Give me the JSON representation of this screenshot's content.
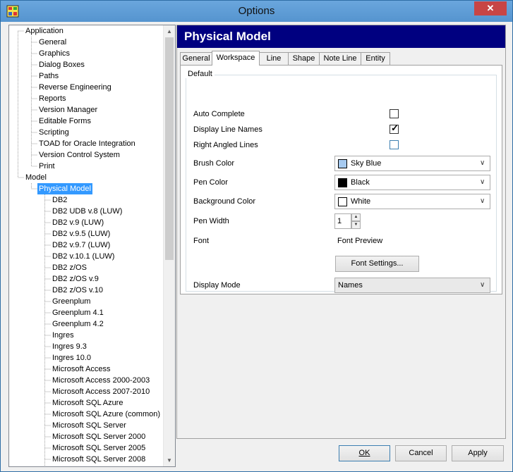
{
  "window": {
    "title": "Options",
    "close_glyph": "✕"
  },
  "tree": {
    "items": [
      "Application",
      "General",
      "Graphics",
      "Dialog Boxes",
      "Paths",
      "Reverse Engineering",
      "Reports",
      "Version Manager",
      "Editable Forms",
      "Scripting",
      "TOAD for Oracle Integration",
      "Version Control System",
      "Print",
      "Model",
      "Physical Model",
      "DB2",
      "DB2 UDB v.8 (LUW)",
      "DB2 v.9 (LUW)",
      "DB2 v.9.5 (LUW)",
      "DB2 v.9.7 (LUW)",
      "DB2 v.10.1 (LUW)",
      "DB2 z/OS",
      "DB2 z/OS v.9",
      "DB2 z/OS v.10",
      "Greenplum",
      "Greenplum 4.1",
      "Greenplum 4.2",
      "Ingres",
      "Ingres 9.3",
      "Ingres 10.0",
      "Microsoft Access",
      "Microsoft Access 2000-2003",
      "Microsoft Access 2007-2010",
      "Microsoft SQL Azure",
      "Microsoft SQL Azure (common)",
      "Microsoft SQL Server",
      "Microsoft SQL Server 2000",
      "Microsoft SQL Server 2005",
      "Microsoft SQL Server 2008"
    ],
    "selected": "Physical Model"
  },
  "panel": {
    "header": "Physical Model",
    "tabs": [
      "General",
      "Workspace",
      "Line",
      "Shape",
      "Note Line",
      "Entity"
    ],
    "active_tab": "Workspace",
    "group_title": "Default",
    "auto_complete": {
      "label": "Auto Complete",
      "checked": false
    },
    "display_line_names": {
      "label": "Display Line Names",
      "checked": true
    },
    "right_angled_lines": {
      "label": "Right Angled Lines",
      "checked": false
    },
    "brush_color": {
      "label": "Brush Color",
      "value": "Sky Blue",
      "swatch": "#a6caf0"
    },
    "pen_color": {
      "label": "Pen Color",
      "value": "Black",
      "swatch": "#000000"
    },
    "background_color": {
      "label": "Background Color",
      "value": "White",
      "swatch": "#ffffff"
    },
    "pen_width": {
      "label": "Pen Width",
      "value": "1"
    },
    "font": {
      "label": "Font",
      "preview": "Font Preview"
    },
    "font_settings_button": "Font Settings...",
    "display_mode": {
      "label": "Display Mode",
      "value": "Names"
    }
  },
  "buttons": {
    "ok": "OK",
    "cancel": "Cancel",
    "apply": "Apply"
  },
  "colors": {
    "titlebar": "#5b9bd5",
    "header": "#000080",
    "selection": "#3399ff"
  },
  "icons": [
    "app-icon",
    "close-icon",
    "checkmark-icon",
    "chevron-down-icon",
    "spin-up-icon",
    "spin-down-icon",
    "scroll-up-icon",
    "scroll-down-icon"
  ]
}
